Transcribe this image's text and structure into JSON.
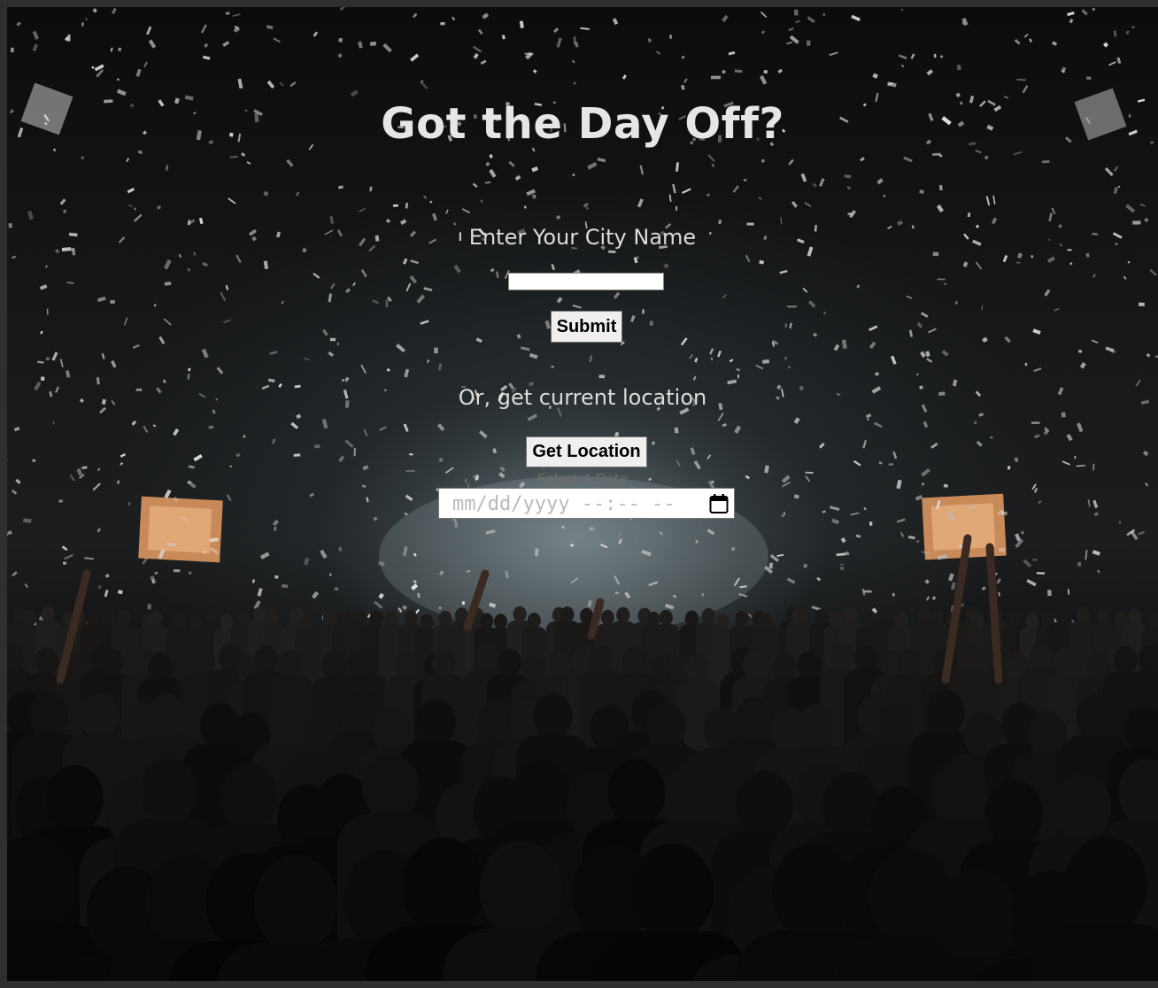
{
  "page": {
    "title": "Got the Day Off?"
  },
  "city_search": {
    "label": "Enter Your City Name",
    "input_value": "",
    "input_placeholder": "",
    "submit_label": "Submit"
  },
  "geolocation": {
    "label": "Or, get current location",
    "button_label": "Get Location"
  },
  "date_picker": {
    "label": "Select A Date",
    "placeholder_text": "mm/dd/yyyy --:-- --",
    "icon": "calendar-icon"
  },
  "colors": {
    "text": "#e6e6e6",
    "button_bg": "#efefef",
    "date_label": "#6e6e6e"
  },
  "background": {
    "description_icon": "concert-crowd-confetti-photo"
  }
}
